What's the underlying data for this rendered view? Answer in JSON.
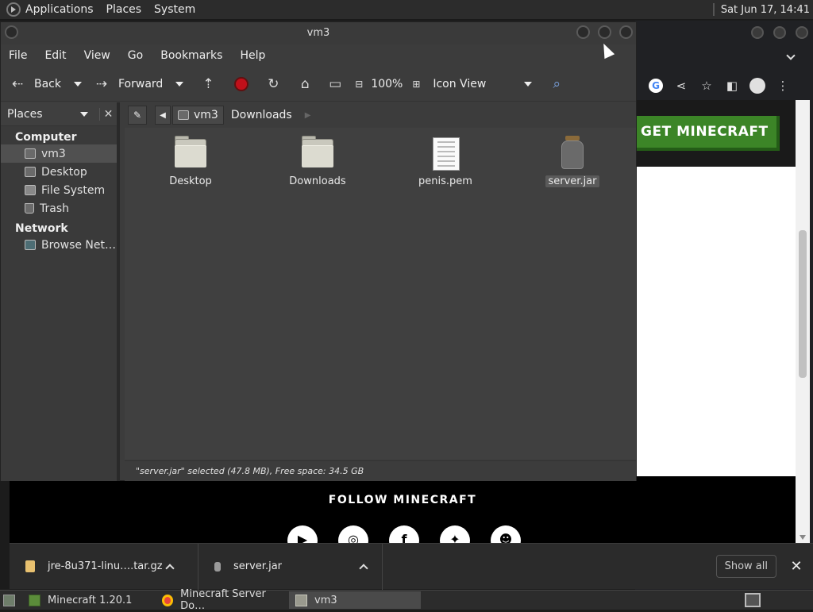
{
  "top_panel": {
    "menus": [
      "Applications",
      "Places",
      "System"
    ],
    "clock": "Sat Jun 17, 14:41"
  },
  "window": {
    "title": "vm3",
    "menu": [
      "File",
      "Edit",
      "View",
      "Go",
      "Bookmarks",
      "Help"
    ],
    "toolbar": {
      "back": "Back",
      "forward": "Forward",
      "zoom": "100%",
      "view_mode": "Icon View"
    },
    "sidebar": {
      "selector": "Places",
      "sections": [
        {
          "heading": "Computer",
          "items": [
            "vm3",
            "Desktop",
            "File System",
            "Trash"
          ]
        },
        {
          "heading": "Network",
          "items": [
            "Browse Net…"
          ]
        }
      ],
      "selected_item": "vm3"
    },
    "path": [
      "vm3",
      "Downloads"
    ],
    "files": [
      {
        "name": "Desktop",
        "icon": "folder-desktop-icon"
      },
      {
        "name": "Downloads",
        "icon": "folder-icon"
      },
      {
        "name": "penis.pem",
        "icon": "text-document-icon"
      },
      {
        "name": "server.jar",
        "icon": "jar-archive-icon",
        "selected": true
      }
    ],
    "status": "\"server.jar\" selected (47.8 MB), Free space: 34.5 GB"
  },
  "browser": {
    "cta": "GET MINECRAFT",
    "footer_heading": "FOLLOW MINECRAFT",
    "social_icons": [
      "youtube-icon",
      "instagram-icon",
      "facebook-icon",
      "twitter-icon",
      "reddit-icon"
    ],
    "downloads": [
      {
        "name": "jre-8u371-linu….tar.gz",
        "color": "#e8c170"
      },
      {
        "name": "server.jar",
        "color": "#9a9a9a"
      }
    ],
    "show_all": "Show all"
  },
  "taskbar": {
    "tasks": [
      {
        "label": "Minecraft 1.20.1",
        "active": false
      },
      {
        "label": "Minecraft Server Do…",
        "active": false
      },
      {
        "label": "vm3",
        "active": true
      }
    ]
  }
}
